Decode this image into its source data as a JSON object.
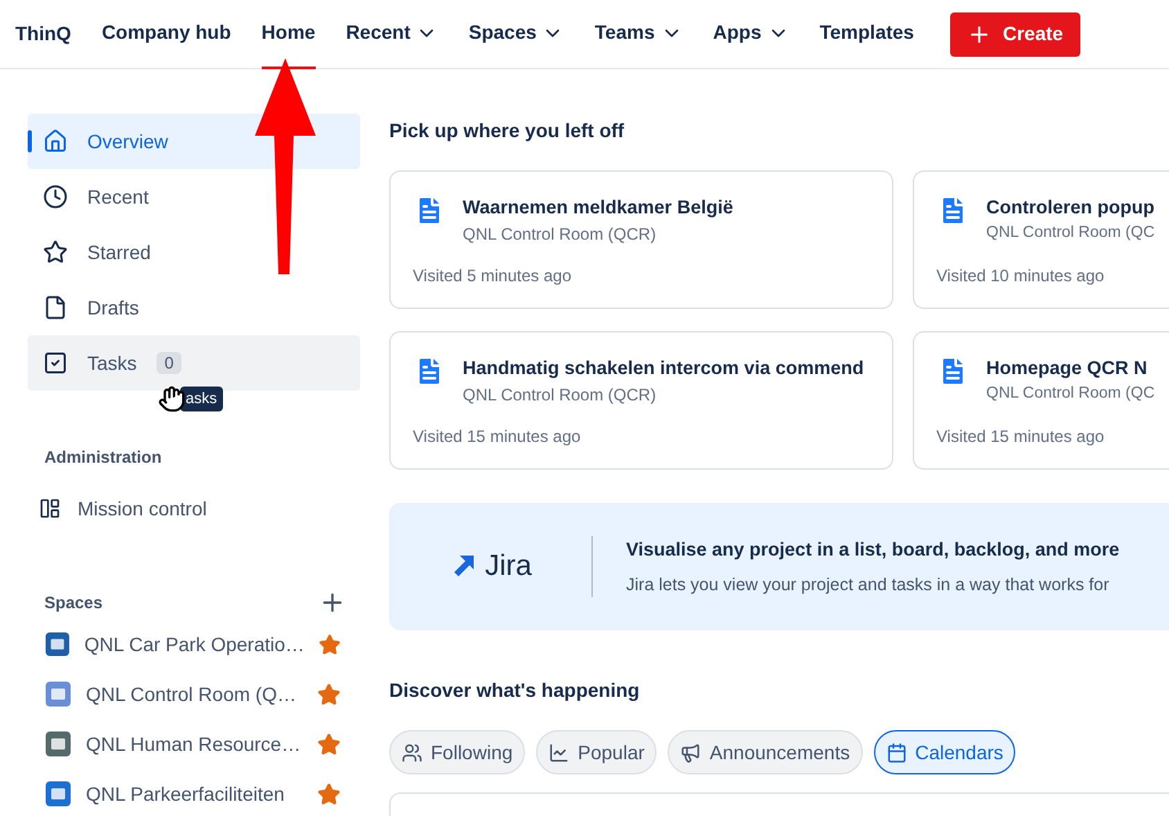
{
  "nav": {
    "brand": "ThinQ",
    "items": [
      {
        "label": "Company hub",
        "selected": false,
        "dropdown": false
      },
      {
        "label": "Home",
        "selected": true,
        "dropdown": false
      },
      {
        "label": "Recent",
        "selected": false,
        "dropdown": true
      },
      {
        "label": "Spaces",
        "selected": false,
        "dropdown": true
      },
      {
        "label": "Teams",
        "selected": false,
        "dropdown": true
      },
      {
        "label": "Apps",
        "selected": false,
        "dropdown": true
      },
      {
        "label": "Templates",
        "selected": false,
        "dropdown": false
      }
    ],
    "create": "Create"
  },
  "sidebar": {
    "items": [
      {
        "kind": "home",
        "label": "Overview",
        "selected": true,
        "hovered": false
      },
      {
        "kind": "clock",
        "label": "Recent",
        "selected": false,
        "hovered": false
      },
      {
        "kind": "star",
        "label": "Starred",
        "selected": false,
        "hovered": false
      },
      {
        "kind": "file",
        "label": "Drafts",
        "selected": false,
        "hovered": false
      },
      {
        "kind": "task",
        "label": "Tasks",
        "selected": false,
        "hovered": true,
        "badge": "0"
      }
    ],
    "tooltip": "asks",
    "admin_title": "Administration",
    "admin_items": [
      {
        "label": "Mission control"
      }
    ],
    "spaces_title": "Spaces",
    "spaces": [
      {
        "kind": "car",
        "label": "QNL Car Park Operatio…",
        "starred": true
      },
      {
        "kind": "room",
        "label": "QNL Control Room (Q…",
        "starred": true
      },
      {
        "kind": "people",
        "label": "QNL Human Resource…",
        "starred": true
      },
      {
        "kind": "parking",
        "label": "QNL Parkeerfaciliteiten",
        "starred": true
      }
    ]
  },
  "recent": {
    "title": "Pick up where you left off",
    "cards": [
      {
        "title": "Waarnemen meldkamer België",
        "space": "QNL Control Room (QCR)",
        "visited": "Visited 5 minutes ago"
      },
      {
        "title": "Controleren popup",
        "space": "QNL Control Room (QC",
        "visited": "Visited 10 minutes ago"
      },
      {
        "title": "Handmatig schakelen intercom via commend",
        "space": "QNL Control Room (QCR)",
        "visited": "Visited 15 minutes ago"
      },
      {
        "title": "Homepage QCR N",
        "space": "QNL Control Room (QC",
        "visited": "Visited 15 minutes ago"
      }
    ]
  },
  "banner": {
    "logo": "Jira",
    "title": "Visualise any project in a list, board, backlog, and more",
    "text": "Jira lets you view your project and tasks in a way that works for"
  },
  "discover": {
    "title": "Discover what's happening",
    "filters": [
      {
        "kind": "people",
        "label": "Following",
        "selected": false
      },
      {
        "kind": "chart",
        "label": "Popular",
        "selected": false
      },
      {
        "kind": "megaphone",
        "label": "Announcements",
        "selected": false
      },
      {
        "kind": "calendar",
        "label": "Calendars",
        "selected": true
      }
    ]
  }
}
